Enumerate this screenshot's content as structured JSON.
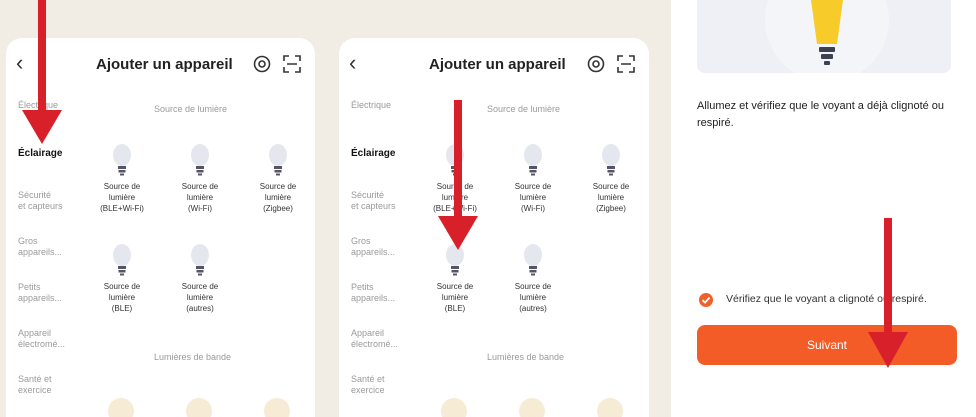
{
  "panel1": {
    "title": "Ajouter un appareil",
    "sidebar": [
      "Électrique",
      "Éclairage",
      "Sécurité\net capteurs",
      "Gros\nappareils...",
      "Petits\nappareils...",
      "Appareil\nélectromé...",
      "Santé et\nexercice"
    ],
    "section_light": "Source de lumière",
    "devices": [
      "Source de\nlumière\n(BLE+Wi-Fi)",
      "Source de\nlumière\n(Wi-Fi)",
      "Source de\nlumière\n(Zigbee)",
      "Source de\nlumière\n(BLE)",
      "Source de\nlumière\n(autres)"
    ],
    "section_strip": "Lumières de bande"
  },
  "panel2": {
    "title": "Ajouter un appareil",
    "sidebar": [
      "Électrique",
      "Éclairage",
      "Sécurité\net capteurs",
      "Gros\nappareils...",
      "Petits\nappareils...",
      "Appareil\nélectromé...",
      "Santé et\nexercice"
    ],
    "section_light": "Source de lumière",
    "devices": [
      "Source de\nlumière\n(BLE+Wi-Fi)",
      "Source de\nlumière\n(Wi-Fi)",
      "Source de\nlumière\n(Zigbee)",
      "Source de\nlumière\n(BLE)",
      "Source de\nlumière\n(autres)"
    ],
    "section_strip": "Lumières de bande"
  },
  "panel3": {
    "instruction": "Allumez et vérifiez que le voyant a déjà clignoté ou respiré.",
    "check_label": "Vérifiez que le voyant a clignoté ou respiré.",
    "button": "Suivant"
  },
  "colors": {
    "accent": "#f35b27",
    "arrow": "#d8202a",
    "background": "#f1ede4"
  }
}
